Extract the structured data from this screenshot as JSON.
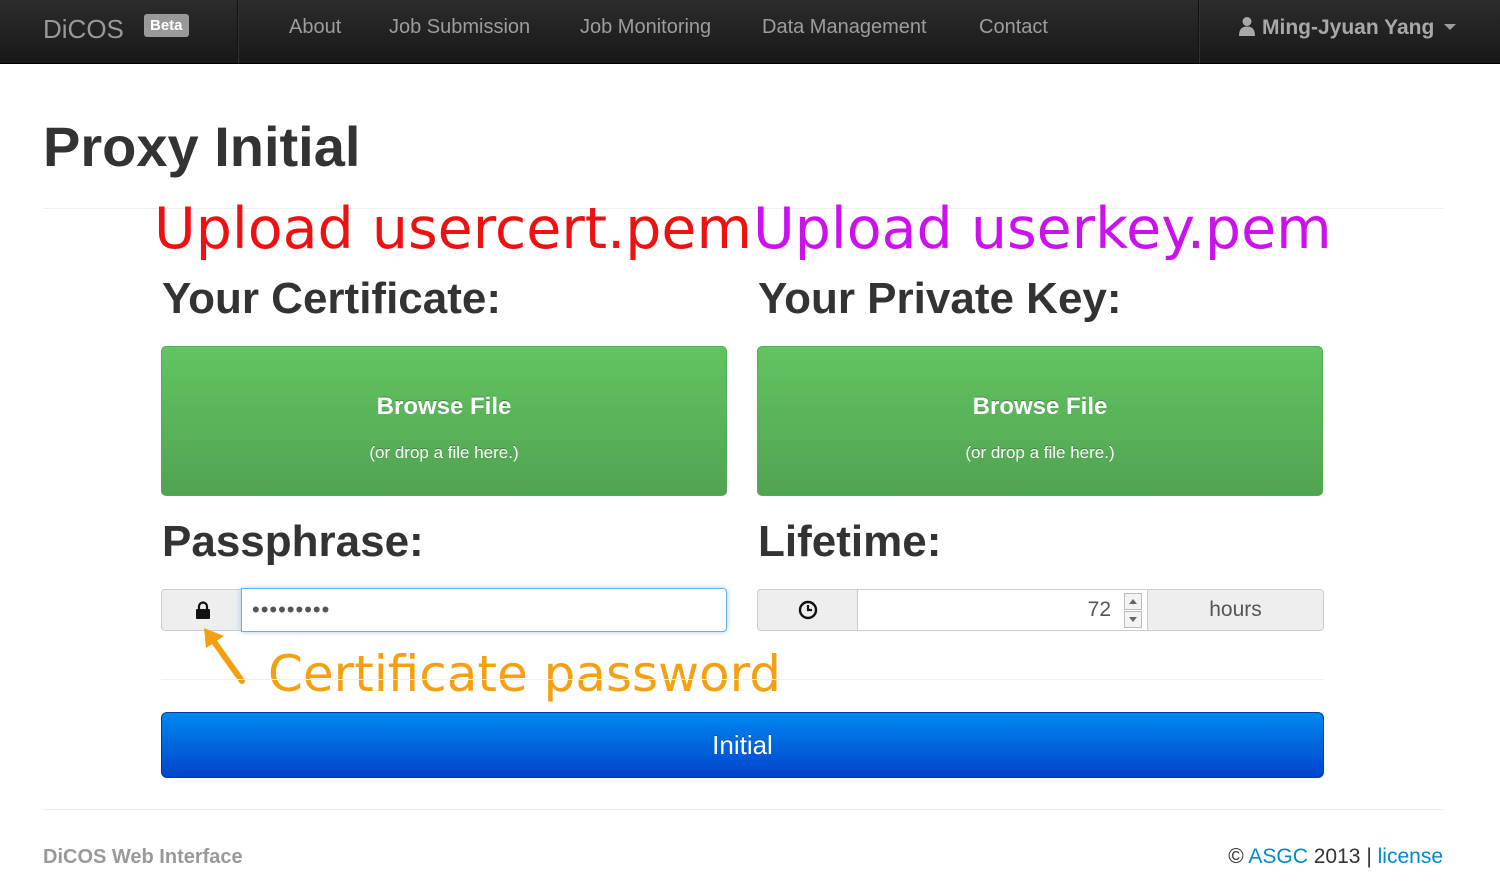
{
  "navbar": {
    "brand": "DiCOS",
    "badge": "Beta",
    "items": [
      "About",
      "Job Submission",
      "Job Monitoring",
      "Data Management",
      "Contact"
    ],
    "user": "Ming-Jyuan Yang"
  },
  "page": {
    "title": "Proxy Initial"
  },
  "annotations": {
    "cert": "Upload usercert.pem",
    "key": "Upload userkey.pem",
    "password": "Certificate password"
  },
  "certificate": {
    "label": "Your Certificate:",
    "browse": "Browse File",
    "drop_hint": "(or drop a file here.)"
  },
  "private_key": {
    "label": "Your Private Key:",
    "browse": "Browse File",
    "drop_hint": "(or drop a file here.)"
  },
  "passphrase": {
    "label": "Passphrase:",
    "value": "•••••••••"
  },
  "lifetime": {
    "label": "Lifetime:",
    "value": "72",
    "unit": "hours"
  },
  "submit": {
    "label": "Initial"
  },
  "footer": {
    "left": "DiCOS Web Interface",
    "copyright": "©",
    "org": "ASGC",
    "year": "2013",
    "separator": "|",
    "license": "license"
  },
  "colors": {
    "annotation_red": "#ee1111",
    "annotation_purple": "#cc11ee",
    "annotation_orange": "#f5a010",
    "dropzone_green": "#5cb85c",
    "primary_blue": "#0066dd",
    "link_blue": "#0088cc"
  },
  "icons": {
    "user": "user-icon",
    "lock": "lock-icon",
    "clock": "clock-icon",
    "arrow": "arrow-icon"
  }
}
